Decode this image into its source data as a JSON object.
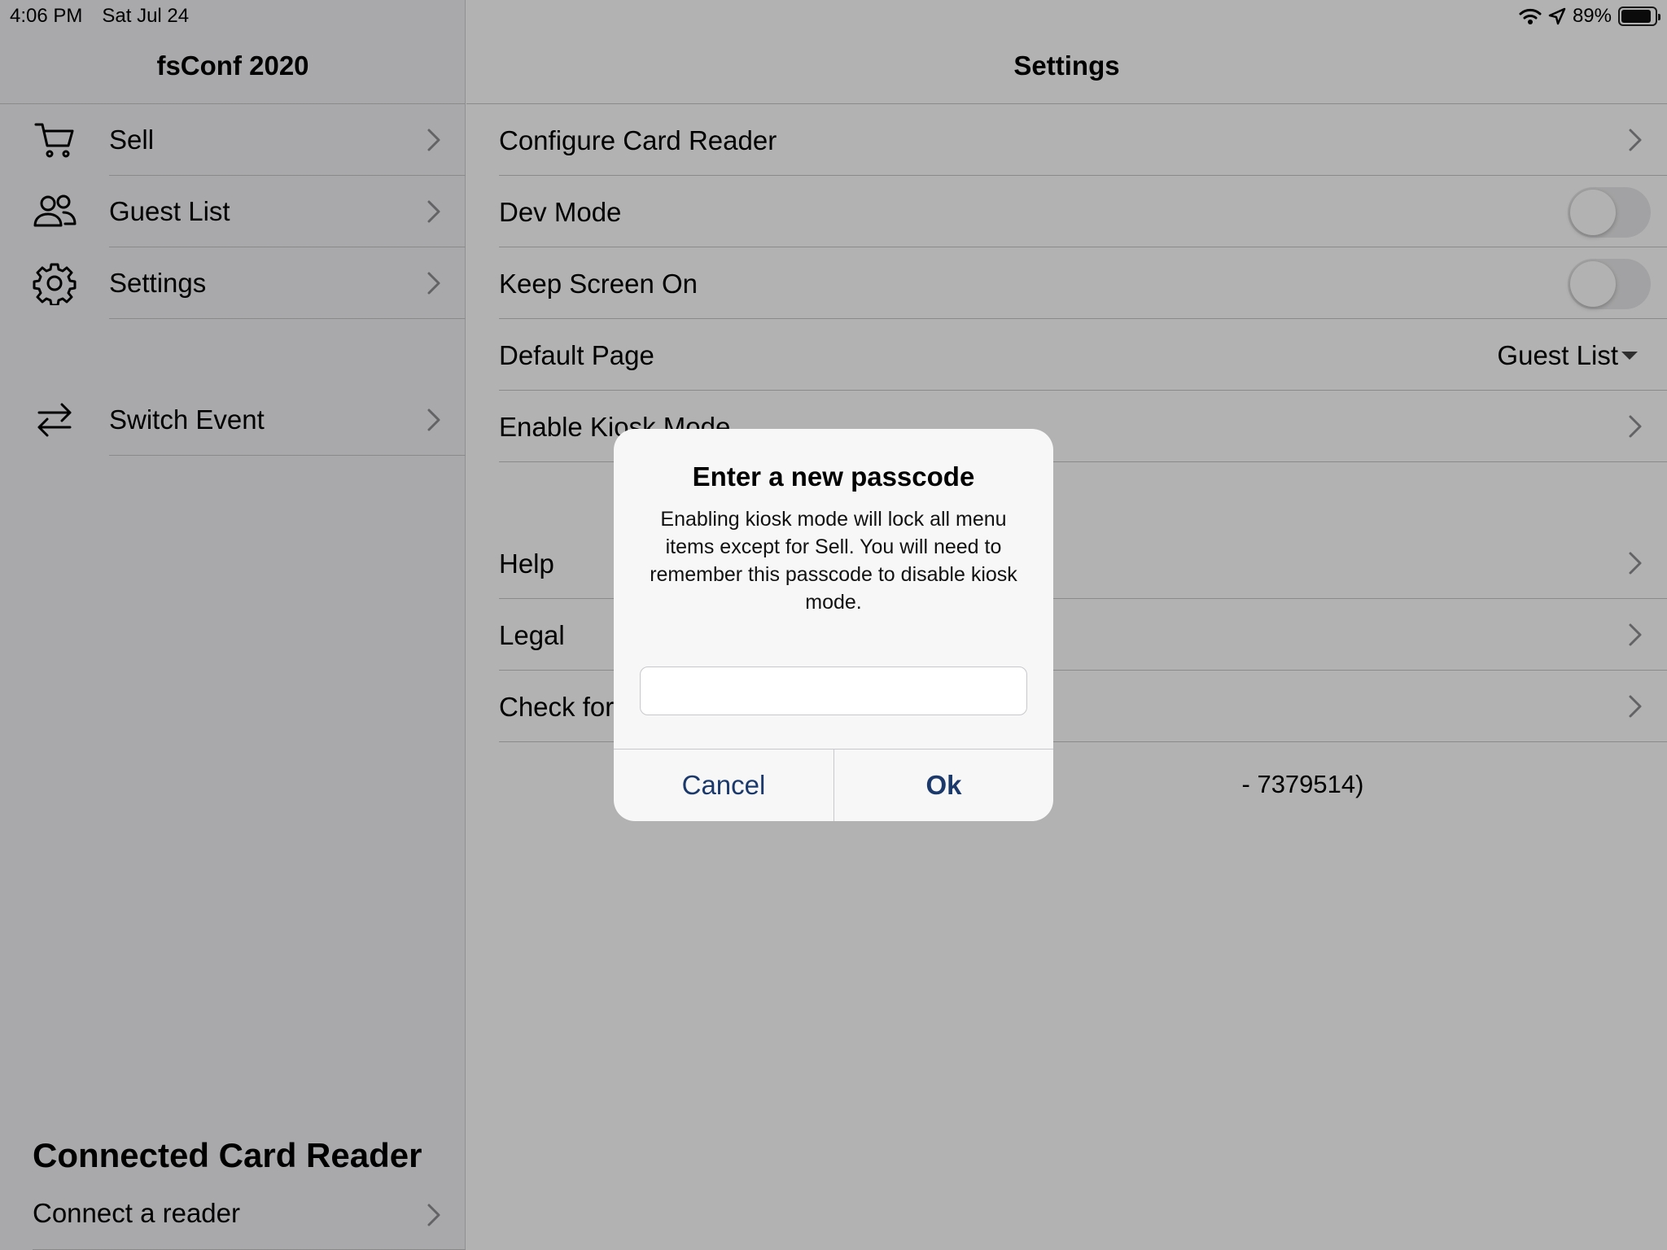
{
  "status": {
    "time": "4:06 PM",
    "date": "Sat Jul 24",
    "battery": "89%",
    "battery_level": 0.89,
    "icons": [
      "wifi-icon",
      "location-arrow-icon",
      "battery-icon"
    ]
  },
  "sidebar": {
    "title": "fsConf 2020",
    "items": [
      {
        "label": "Sell",
        "icon": "cart-icon"
      },
      {
        "label": "Guest List",
        "icon": "people-icon"
      },
      {
        "label": "Settings",
        "icon": "gear-icon"
      },
      {
        "label": "Switch Event",
        "icon": "swap-arrows-icon"
      }
    ],
    "reader": {
      "title": "Connected Card Reader",
      "row_label": "Connect a reader"
    }
  },
  "main": {
    "title": "Settings",
    "rows": [
      {
        "label": "Configure Card Reader",
        "type": "nav"
      },
      {
        "label": "Dev Mode",
        "type": "toggle",
        "on": false
      },
      {
        "label": "Keep Screen On",
        "type": "toggle",
        "on": false
      },
      {
        "label": "Default Page",
        "type": "select",
        "value": "Guest List"
      },
      {
        "label": "Enable Kiosk Mode",
        "type": "nav"
      },
      {
        "label": "Help",
        "type": "nav"
      },
      {
        "label": "Legal",
        "type": "nav"
      },
      {
        "label": "Check for",
        "type": "nav"
      }
    ],
    "version_text": "- 7379514)"
  },
  "alert": {
    "title": "Enter a new passcode",
    "message": "Enabling kiosk mode will lock all menu items except for Sell. You will need to remember this passcode to disable kiosk mode.",
    "input_value": "",
    "cancel_label": "Cancel",
    "ok_label": "Ok"
  },
  "colors": {
    "accent": "#1b3a6b",
    "separator": "#c6c6c8",
    "sidebar_bg": "#f2f2f7"
  }
}
